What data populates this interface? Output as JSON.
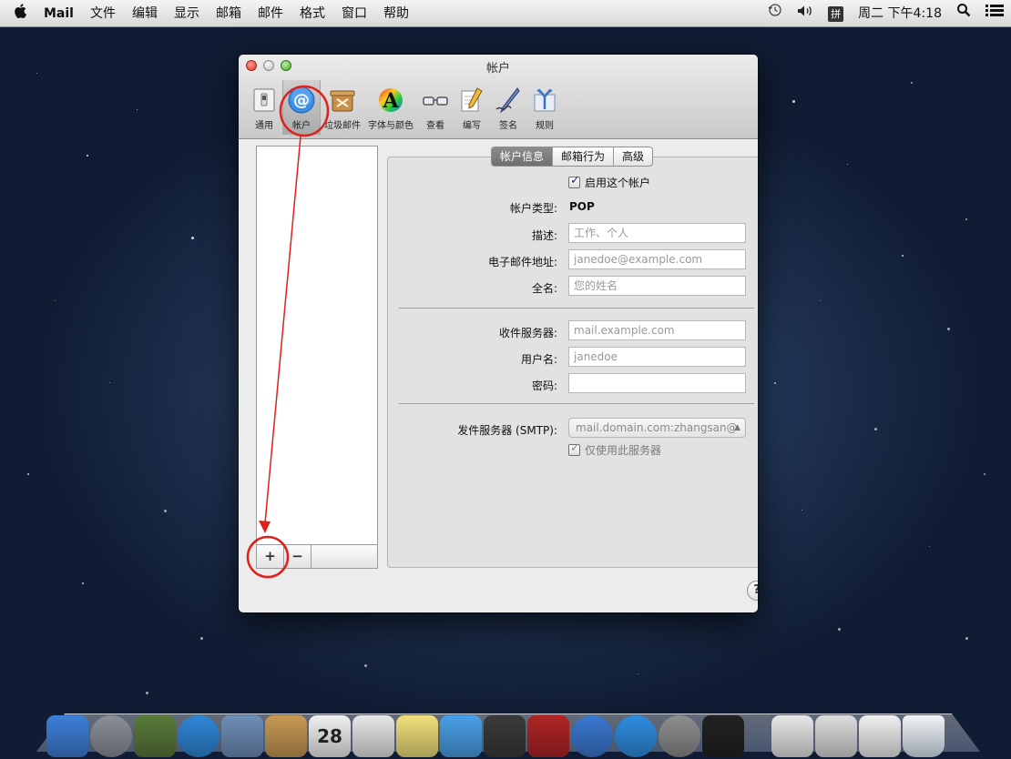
{
  "menubar": {
    "app_name": "Mail",
    "items": [
      "文件",
      "编辑",
      "显示",
      "邮箱",
      "邮件",
      "格式",
      "窗口",
      "帮助"
    ],
    "ime_label": "拼",
    "clock": "周二 下午4:18"
  },
  "window": {
    "title": "帐户",
    "toolbar": [
      {
        "label": "通用",
        "icon": "general-switch-icon"
      },
      {
        "label": "帐户",
        "icon": "at-sign-icon"
      },
      {
        "label": "垃圾邮件",
        "icon": "junk-bin-icon"
      },
      {
        "label": "字体与颜色",
        "icon": "font-a-icon"
      },
      {
        "label": "查看",
        "icon": "glasses-icon"
      },
      {
        "label": "编写",
        "icon": "pencil-icon"
      },
      {
        "label": "签名",
        "icon": "pen-signature-icon"
      },
      {
        "label": "规则",
        "icon": "rules-arrows-icon"
      }
    ],
    "list_footer": {
      "add": "+",
      "remove": "−"
    },
    "tabs": [
      "帐户信息",
      "邮箱行为",
      "高级"
    ],
    "active_tab": "帐户信息",
    "enable_checkbox": "启用这个帐户",
    "account_type": {
      "label": "帐户类型:",
      "value": "POP"
    },
    "fields": {
      "description": {
        "label": "描述:",
        "placeholder": "工作、个人"
      },
      "email": {
        "label": "电子邮件地址:",
        "placeholder": "janedoe@example.com"
      },
      "full_name": {
        "label": "全名:",
        "placeholder": "您的姓名"
      },
      "incoming_server": {
        "label": "收件服务器:",
        "placeholder": "mail.example.com"
      },
      "username": {
        "label": "用户名:",
        "placeholder": "janedoe"
      },
      "password": {
        "label": "密码:",
        "value": ""
      }
    },
    "smtp": {
      "label": "发件服务器 (SMTP):",
      "value": "mail.domain.com:zhangsan@",
      "only_this_server": "仅使用此服务器"
    },
    "help": "?"
  },
  "dock": {
    "calendar_day": "28",
    "apps": [
      {
        "name": "finder",
        "color": "#3d7fd8"
      },
      {
        "name": "launchpad",
        "color": "#8a8f99"
      },
      {
        "name": "mission-control",
        "color": "#5a7a3a"
      },
      {
        "name": "safari",
        "color": "#2f87d8"
      },
      {
        "name": "mail",
        "color": "#6f8fb8"
      },
      {
        "name": "contacts",
        "color": "#c89a55"
      },
      {
        "name": "calendar",
        "color": "#f2f2f2"
      },
      {
        "name": "reminders",
        "color": "#e8e8e8"
      },
      {
        "name": "notes",
        "color": "#f0e07a"
      },
      {
        "name": "messages",
        "color": "#4aa0e8"
      },
      {
        "name": "facetime",
        "color": "#3a3a3a"
      },
      {
        "name": "photo-booth",
        "color": "#b02525"
      },
      {
        "name": "itunes",
        "color": "#3a78d0"
      },
      {
        "name": "app-store",
        "color": "#2f8de0"
      },
      {
        "name": "system-preferences",
        "color": "#8e8e8e"
      },
      {
        "name": "terminal",
        "color": "#222222"
      }
    ],
    "stacks": [
      {
        "name": "documents-stack",
        "color": "#e8e8e8"
      },
      {
        "name": "downloads-stack",
        "color": "#dcdcdc"
      },
      {
        "name": "recent-stack",
        "color": "#f0f0f0"
      }
    ]
  },
  "annotation_color": "#e0201a"
}
